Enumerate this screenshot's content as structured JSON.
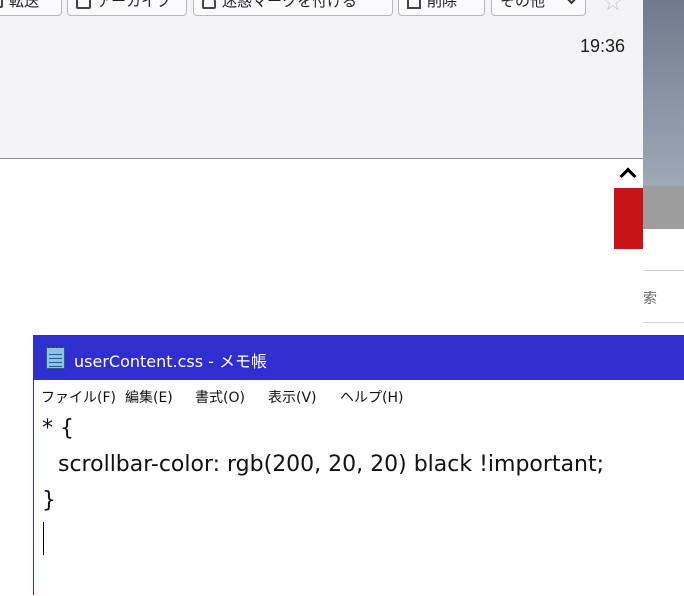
{
  "mail_window": {
    "toolbar": {
      "forward_label": "転送",
      "archive_label": "アーカイブ",
      "junk_label": "迷惑マークを付ける",
      "delete_label": "削除",
      "other_label": "その他"
    },
    "message_time": "19:36"
  },
  "right_strip": {
    "search_fragment": "索"
  },
  "notepad": {
    "title": "userContent.css - メモ帳",
    "menu": [
      "ファイル(F)",
      "編集(E)",
      "書式(O)",
      "表示(V)",
      "ヘルプ(H)"
    ],
    "content_lines": [
      "* {",
      "scrollbar-color: rgb(200, 20, 20) black !important;",
      "}"
    ]
  },
  "colors": {
    "scrollbar_thumb": "#c81414",
    "notepad_titlebar": "#2f2fd0",
    "toolbar_bg": "#f4f4f6"
  }
}
